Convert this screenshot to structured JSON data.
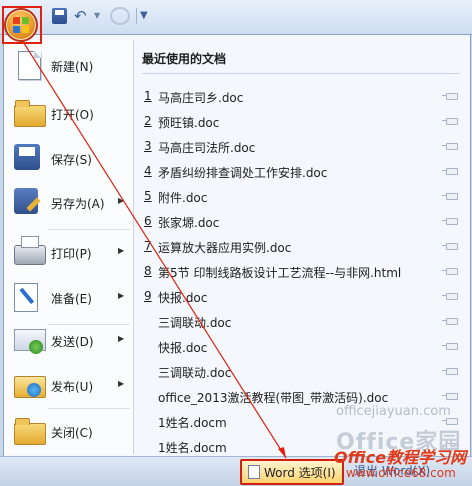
{
  "quick_access": {
    "save_icon": "save-icon",
    "undo_icon": "undo-icon",
    "redo_icon": "redo-icon",
    "customize_icon": "customize-icon"
  },
  "commands": [
    {
      "label": "新建(N)",
      "icon": "new-document-icon",
      "has_submenu": false
    },
    {
      "label": "打开(O)",
      "icon": "open-folder-icon",
      "has_submenu": false
    },
    {
      "label": "保存(S)",
      "icon": "save-icon",
      "has_submenu": false
    },
    {
      "label": "另存为(A)",
      "icon": "save-as-icon",
      "has_submenu": true
    },
    {
      "label": "打印(P)",
      "icon": "print-icon",
      "has_submenu": true
    },
    {
      "label": "准备(E)",
      "icon": "prepare-icon",
      "has_submenu": true
    },
    {
      "label": "发送(D)",
      "icon": "send-icon",
      "has_submenu": true
    },
    {
      "label": "发布(U)",
      "icon": "publish-icon",
      "has_submenu": true
    },
    {
      "label": "关闭(C)",
      "icon": "close-folder-icon",
      "has_submenu": false
    }
  ],
  "recent": {
    "title": "最近使用的文档",
    "items": [
      {
        "num": "1",
        "name": "马高庄司乡.doc"
      },
      {
        "num": "2",
        "name": "预旺镇.doc"
      },
      {
        "num": "3",
        "name": "马高庄司法所.doc"
      },
      {
        "num": "4",
        "name": "矛盾纠纷排查调处工作安排.doc"
      },
      {
        "num": "5",
        "name": "附件.doc"
      },
      {
        "num": "6",
        "name": "张家塬.doc"
      },
      {
        "num": "7",
        "name": "运算放大器应用实例.doc"
      },
      {
        "num": "8",
        "name": "第5节 印制线路板设计工艺流程--与非网.html"
      },
      {
        "num": "9",
        "name": "快报.doc"
      },
      {
        "num": "",
        "name": "三调联动.doc"
      },
      {
        "num": "",
        "name": "快报.doc"
      },
      {
        "num": "",
        "name": "三调联动.doc"
      },
      {
        "num": "",
        "name": "office_2013激活教程(带图_带激活码).doc"
      },
      {
        "num": "",
        "name": "1姓名.docm"
      },
      {
        "num": "",
        "name": "1姓名.docm"
      }
    ]
  },
  "bottom": {
    "word_options": "Word 选项(I)",
    "exit": "退出 Word(X)"
  },
  "watermark": {
    "line1": "officejiayuan.com",
    "line2": "Office家园",
    "line3": "Office教程学习网",
    "line4": "www.office68.com"
  },
  "colors": {
    "annotation": "#e02212",
    "menu_bg": "#f4f7fc",
    "highlight_fill": "#ffd470"
  }
}
